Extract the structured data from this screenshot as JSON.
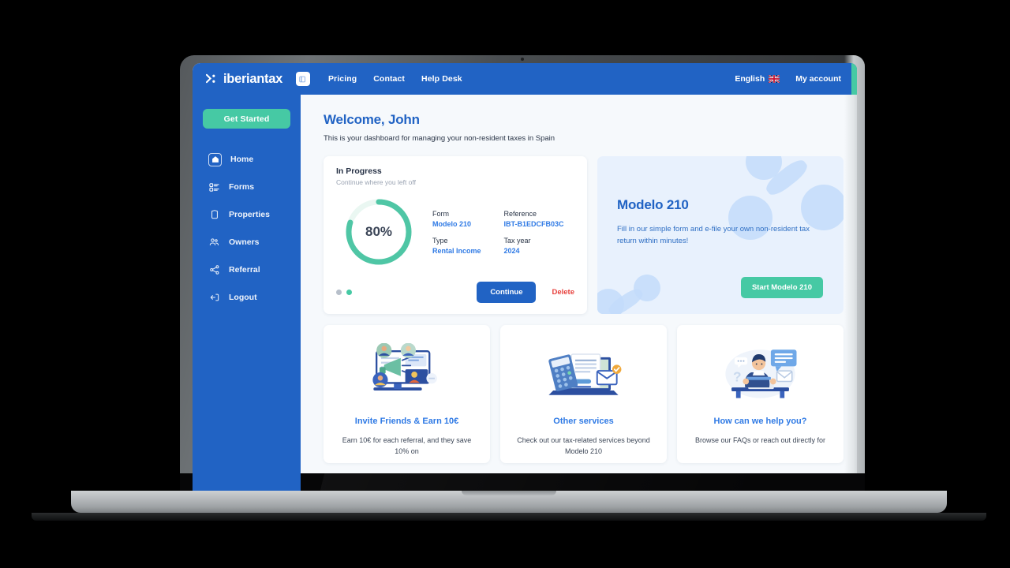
{
  "brand": {
    "name": "iberiantax",
    "logo_icon": "iberiantax-logo-icon"
  },
  "topbar": {
    "collapse_icon": "collapse-sidebar-icon",
    "nav": [
      {
        "label": "Pricing",
        "name": "pricing"
      },
      {
        "label": "Contact",
        "name": "contact"
      },
      {
        "label": "Help Desk",
        "name": "help-desk"
      }
    ],
    "language": {
      "label": "English",
      "flag_icon": "uk-flag-icon"
    },
    "account_label": "My account"
  },
  "sidebar": {
    "cta_label": "Get Started",
    "items": [
      {
        "label": "Home",
        "icon": "home-icon",
        "active": true
      },
      {
        "label": "Forms",
        "icon": "forms-list-icon",
        "active": false
      },
      {
        "label": "Properties",
        "icon": "property-tag-icon",
        "active": false
      },
      {
        "label": "Owners",
        "icon": "owners-people-icon",
        "active": false
      },
      {
        "label": "Referral",
        "icon": "share-network-icon",
        "active": false
      },
      {
        "label": "Logout",
        "icon": "logout-icon",
        "active": false
      }
    ]
  },
  "main": {
    "greeting": "Welcome, John",
    "subtitle": "This is your dashboard for managing your non-resident taxes in Spain",
    "in_progress": {
      "title": "In Progress",
      "subtitle": "Continue where you left off",
      "progress_percent": "80%",
      "progress_value": 80,
      "fields": [
        {
          "label": "Form",
          "value": "Modelo 210"
        },
        {
          "label": "Reference",
          "value": "IBT-B1EDCFB03C"
        },
        {
          "label": "Type",
          "value": "Rental Income"
        },
        {
          "label": "Tax year",
          "value": "2024"
        }
      ],
      "dots": [
        {
          "active": false
        },
        {
          "active": true
        }
      ],
      "continue_label": "Continue",
      "delete_label": "Delete"
    },
    "promo": {
      "heading": "Modelo 210",
      "body": "Fill in our simple form and e-file your own non-resident tax return within minutes!",
      "button_label": "Start Modelo 210"
    },
    "cards": [
      {
        "title": "Invite Friends & Earn 10€",
        "desc": "Earn 10€ for each referral, and they save 10% on",
        "art_icon": "referral-megaphone-illustration"
      },
      {
        "title": "Other services",
        "desc": "Check out our tax-related services beyond Modelo 210",
        "art_icon": "calculator-documents-illustration"
      },
      {
        "title": "How can we help you?",
        "desc": "Browse our FAQs or reach out directly for",
        "art_icon": "support-agent-illustration"
      }
    ]
  },
  "colors": {
    "brand_blue": "#2163c4",
    "accent_teal": "#46c9a4",
    "link_blue": "#2f7ae5",
    "danger_red": "#e7413d",
    "promo_bg": "#e8f1fd",
    "page_bg": "#f6f9fc"
  }
}
